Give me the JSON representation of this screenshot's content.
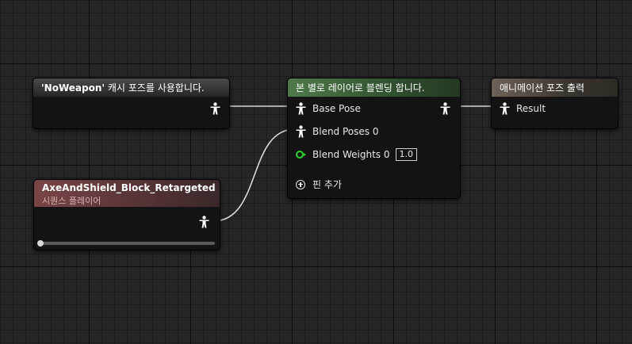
{
  "nodes": {
    "cached_pose": {
      "title_bold": "'NoWeapon'",
      "title_rest": " 캐시 포즈를 사용합니다."
    },
    "layered_blend": {
      "title": "본 별로 레이어로 블렌딩 합니다.",
      "pins": {
        "base_pose": "Base Pose",
        "blend_poses": "Blend Poses 0",
        "blend_weights": "Blend Weights 0",
        "blend_weights_value": "1.0",
        "add_pin": "핀 추가"
      }
    },
    "output_pose": {
      "title": "애니메이션 포즈 출력",
      "pins": {
        "result": "Result"
      }
    },
    "sequence_player": {
      "title": "AxeAndShield_Block_Retargeted",
      "subtitle": "시퀀스 플레이어",
      "play_position": 0
    }
  },
  "icons": {
    "pose": "pose-pin-icon",
    "float": "float-pin-icon",
    "add": "add-pin-icon"
  },
  "colors": {
    "graph_bg": "#262626",
    "wire": "#d9d9d9",
    "float_pin": "#2fd52f",
    "blend_header": "#4f7a4a",
    "sequence_header": "#7a4546",
    "output_header": "#6d6258"
  }
}
